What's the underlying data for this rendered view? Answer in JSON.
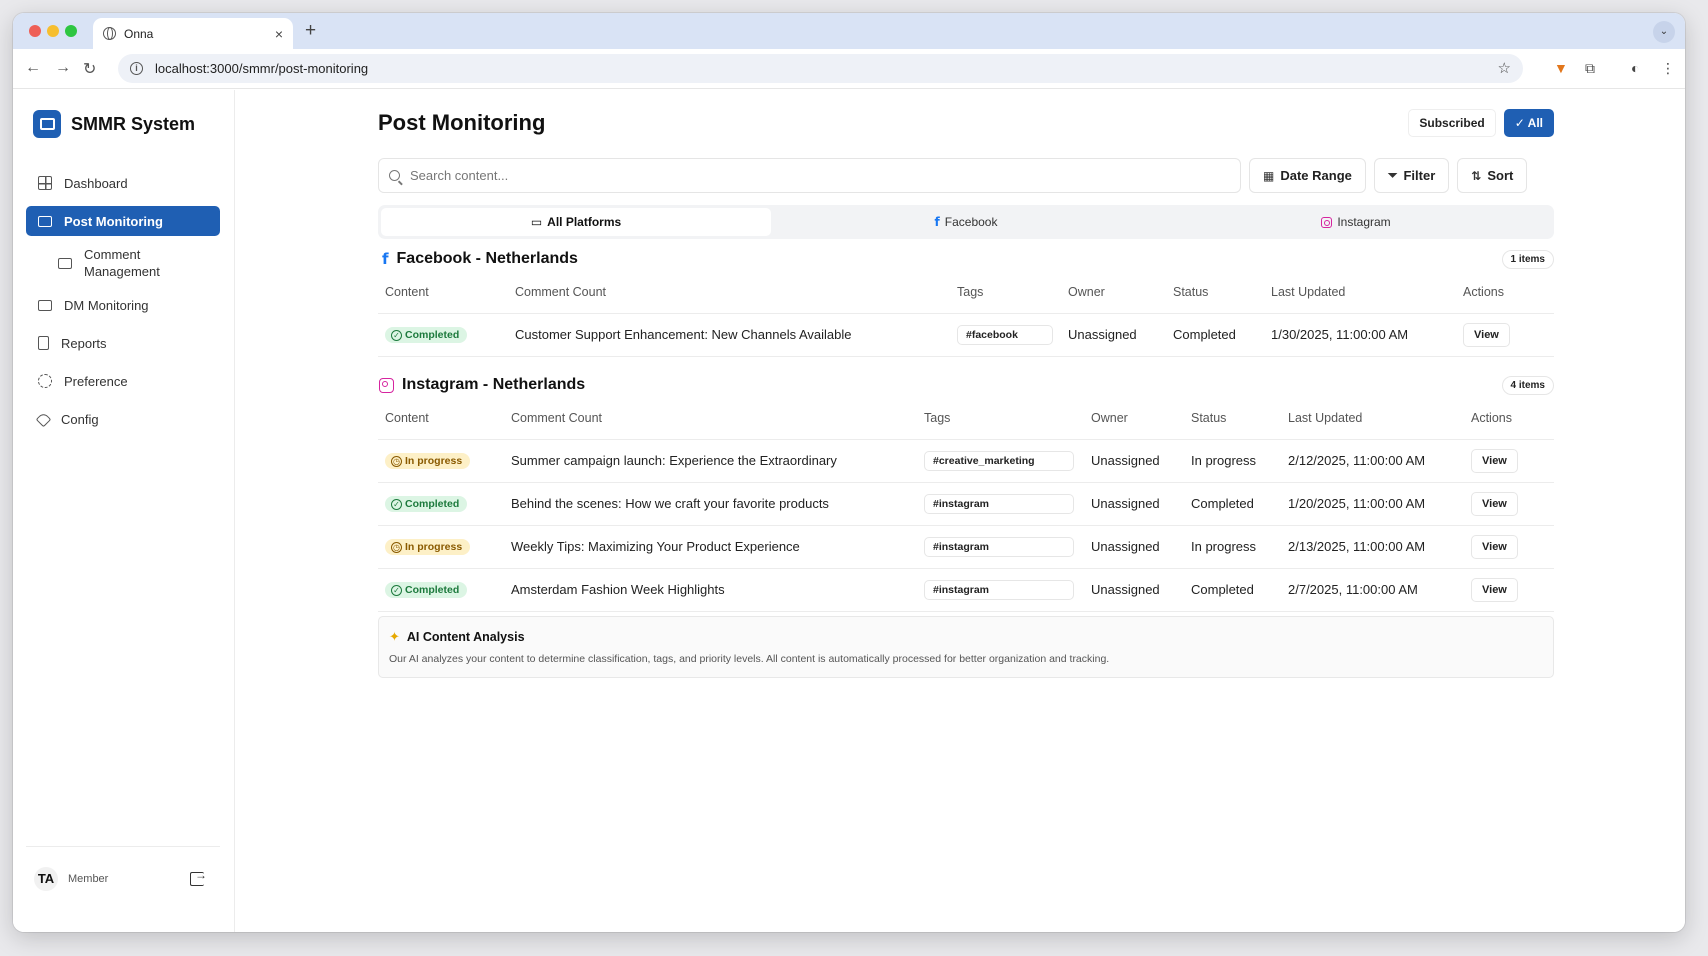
{
  "browser": {
    "tab_title": "Onna",
    "url": "localhost:3000/smmr/post-monitoring"
  },
  "sidebar": {
    "brand": "SMMR System",
    "items": [
      {
        "label": "Dashboard",
        "icon": "dashboard-icon"
      },
      {
        "label": "Post Monitoring",
        "icon": "monitor-icon",
        "active": true
      },
      {
        "label": "Comment Management",
        "icon": "comment-icon",
        "sub": true
      },
      {
        "label": "DM Monitoring",
        "icon": "message-icon"
      },
      {
        "label": "Reports",
        "icon": "document-icon"
      },
      {
        "label": "Preference",
        "icon": "gear-icon"
      },
      {
        "label": "Config",
        "icon": "tag-icon"
      }
    ],
    "user": {
      "initials": "TA",
      "role": "Member"
    }
  },
  "header": {
    "title": "Post Monitoring",
    "subscribed_label": "Subscribed",
    "all_label": "✓ All"
  },
  "toolbar": {
    "search_placeholder": "Search content...",
    "date_range_label": "Date Range",
    "filter_label": "Filter",
    "sort_label": "Sort"
  },
  "platforms": [
    {
      "label": "All Platforms",
      "active": true
    },
    {
      "label": "Facebook"
    },
    {
      "label": "Instagram"
    }
  ],
  "columns": {
    "content": "Content",
    "comment_count": "Comment Count",
    "tags": "Tags",
    "owner": "Owner",
    "status": "Status",
    "last_updated": "Last Updated",
    "actions": "Actions"
  },
  "facebook": {
    "title": "Facebook - Netherlands",
    "count": "1 items",
    "rows": [
      {
        "badge": "Completed",
        "badge_type": "completed",
        "text": "Customer Support Enhancement: New Channels Available",
        "tag": "#facebook",
        "owner": "Unassigned",
        "status": "Completed",
        "updated": "1/30/2025, 11:00:00 AM",
        "action": "View"
      }
    ]
  },
  "instagram": {
    "title": "Instagram - Netherlands",
    "count": "4 items",
    "rows": [
      {
        "badge": "In progress",
        "badge_type": "progress",
        "text": "Summer campaign launch: Experience the Extraordinary",
        "tag": "#creative_marketing",
        "owner": "Unassigned",
        "status": "In progress",
        "updated": "2/12/2025, 11:00:00 AM",
        "action": "View"
      },
      {
        "badge": "Completed",
        "badge_type": "completed",
        "text": "Behind the scenes: How we craft your favorite products",
        "tag": "#instagram",
        "owner": "Unassigned",
        "status": "Completed",
        "updated": "1/20/2025, 11:00:00 AM",
        "action": "View"
      },
      {
        "badge": "In progress",
        "badge_type": "progress",
        "text": "Weekly Tips: Maximizing Your Product Experience",
        "tag": "#instagram",
        "owner": "Unassigned",
        "status": "In progress",
        "updated": "2/13/2025, 11:00:00 AM",
        "action": "View"
      },
      {
        "badge": "Completed",
        "badge_type": "completed",
        "text": "Amsterdam Fashion Week Highlights",
        "tag": "#instagram",
        "owner": "Unassigned",
        "status": "Completed",
        "updated": "2/7/2025, 11:00:00 AM",
        "action": "View"
      }
    ]
  },
  "ai": {
    "title": "AI Content Analysis",
    "description": "Our AI analyzes your content to determine classification, tags, and priority levels. All content is automatically processed for better organization and tracking."
  },
  "colors": {
    "primary": "#1f5fb3",
    "completed_bg": "#dcf5e4",
    "progress_bg": "#fdf0c7",
    "facebook": "#1877f2",
    "instagram": "#d6249f"
  }
}
